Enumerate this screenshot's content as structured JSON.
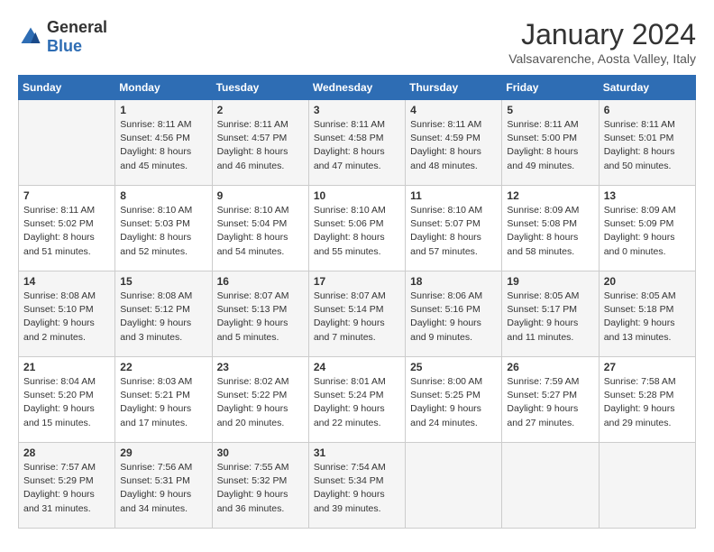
{
  "logo": {
    "general": "General",
    "blue": "Blue"
  },
  "title": "January 2024",
  "subtitle": "Valsavarenche, Aosta Valley, Italy",
  "weekdays": [
    "Sunday",
    "Monday",
    "Tuesday",
    "Wednesday",
    "Thursday",
    "Friday",
    "Saturday"
  ],
  "weeks": [
    [
      {
        "day": "",
        "info": ""
      },
      {
        "day": "1",
        "info": "Sunrise: 8:11 AM\nSunset: 4:56 PM\nDaylight: 8 hours\nand 45 minutes."
      },
      {
        "day": "2",
        "info": "Sunrise: 8:11 AM\nSunset: 4:57 PM\nDaylight: 8 hours\nand 46 minutes."
      },
      {
        "day": "3",
        "info": "Sunrise: 8:11 AM\nSunset: 4:58 PM\nDaylight: 8 hours\nand 47 minutes."
      },
      {
        "day": "4",
        "info": "Sunrise: 8:11 AM\nSunset: 4:59 PM\nDaylight: 8 hours\nand 48 minutes."
      },
      {
        "day": "5",
        "info": "Sunrise: 8:11 AM\nSunset: 5:00 PM\nDaylight: 8 hours\nand 49 minutes."
      },
      {
        "day": "6",
        "info": "Sunrise: 8:11 AM\nSunset: 5:01 PM\nDaylight: 8 hours\nand 50 minutes."
      }
    ],
    [
      {
        "day": "7",
        "info": "Sunrise: 8:11 AM\nSunset: 5:02 PM\nDaylight: 8 hours\nand 51 minutes."
      },
      {
        "day": "8",
        "info": "Sunrise: 8:10 AM\nSunset: 5:03 PM\nDaylight: 8 hours\nand 52 minutes."
      },
      {
        "day": "9",
        "info": "Sunrise: 8:10 AM\nSunset: 5:04 PM\nDaylight: 8 hours\nand 54 minutes."
      },
      {
        "day": "10",
        "info": "Sunrise: 8:10 AM\nSunset: 5:06 PM\nDaylight: 8 hours\nand 55 minutes."
      },
      {
        "day": "11",
        "info": "Sunrise: 8:10 AM\nSunset: 5:07 PM\nDaylight: 8 hours\nand 57 minutes."
      },
      {
        "day": "12",
        "info": "Sunrise: 8:09 AM\nSunset: 5:08 PM\nDaylight: 8 hours\nand 58 minutes."
      },
      {
        "day": "13",
        "info": "Sunrise: 8:09 AM\nSunset: 5:09 PM\nDaylight: 9 hours\nand 0 minutes."
      }
    ],
    [
      {
        "day": "14",
        "info": "Sunrise: 8:08 AM\nSunset: 5:10 PM\nDaylight: 9 hours\nand 2 minutes."
      },
      {
        "day": "15",
        "info": "Sunrise: 8:08 AM\nSunset: 5:12 PM\nDaylight: 9 hours\nand 3 minutes."
      },
      {
        "day": "16",
        "info": "Sunrise: 8:07 AM\nSunset: 5:13 PM\nDaylight: 9 hours\nand 5 minutes."
      },
      {
        "day": "17",
        "info": "Sunrise: 8:07 AM\nSunset: 5:14 PM\nDaylight: 9 hours\nand 7 minutes."
      },
      {
        "day": "18",
        "info": "Sunrise: 8:06 AM\nSunset: 5:16 PM\nDaylight: 9 hours\nand 9 minutes."
      },
      {
        "day": "19",
        "info": "Sunrise: 8:05 AM\nSunset: 5:17 PM\nDaylight: 9 hours\nand 11 minutes."
      },
      {
        "day": "20",
        "info": "Sunrise: 8:05 AM\nSunset: 5:18 PM\nDaylight: 9 hours\nand 13 minutes."
      }
    ],
    [
      {
        "day": "21",
        "info": "Sunrise: 8:04 AM\nSunset: 5:20 PM\nDaylight: 9 hours\nand 15 minutes."
      },
      {
        "day": "22",
        "info": "Sunrise: 8:03 AM\nSunset: 5:21 PM\nDaylight: 9 hours\nand 17 minutes."
      },
      {
        "day": "23",
        "info": "Sunrise: 8:02 AM\nSunset: 5:22 PM\nDaylight: 9 hours\nand 20 minutes."
      },
      {
        "day": "24",
        "info": "Sunrise: 8:01 AM\nSunset: 5:24 PM\nDaylight: 9 hours\nand 22 minutes."
      },
      {
        "day": "25",
        "info": "Sunrise: 8:00 AM\nSunset: 5:25 PM\nDaylight: 9 hours\nand 24 minutes."
      },
      {
        "day": "26",
        "info": "Sunrise: 7:59 AM\nSunset: 5:27 PM\nDaylight: 9 hours\nand 27 minutes."
      },
      {
        "day": "27",
        "info": "Sunrise: 7:58 AM\nSunset: 5:28 PM\nDaylight: 9 hours\nand 29 minutes."
      }
    ],
    [
      {
        "day": "28",
        "info": "Sunrise: 7:57 AM\nSunset: 5:29 PM\nDaylight: 9 hours\nand 31 minutes."
      },
      {
        "day": "29",
        "info": "Sunrise: 7:56 AM\nSunset: 5:31 PM\nDaylight: 9 hours\nand 34 minutes."
      },
      {
        "day": "30",
        "info": "Sunrise: 7:55 AM\nSunset: 5:32 PM\nDaylight: 9 hours\nand 36 minutes."
      },
      {
        "day": "31",
        "info": "Sunrise: 7:54 AM\nSunset: 5:34 PM\nDaylight: 9 hours\nand 39 minutes."
      },
      {
        "day": "",
        "info": ""
      },
      {
        "day": "",
        "info": ""
      },
      {
        "day": "",
        "info": ""
      }
    ]
  ]
}
